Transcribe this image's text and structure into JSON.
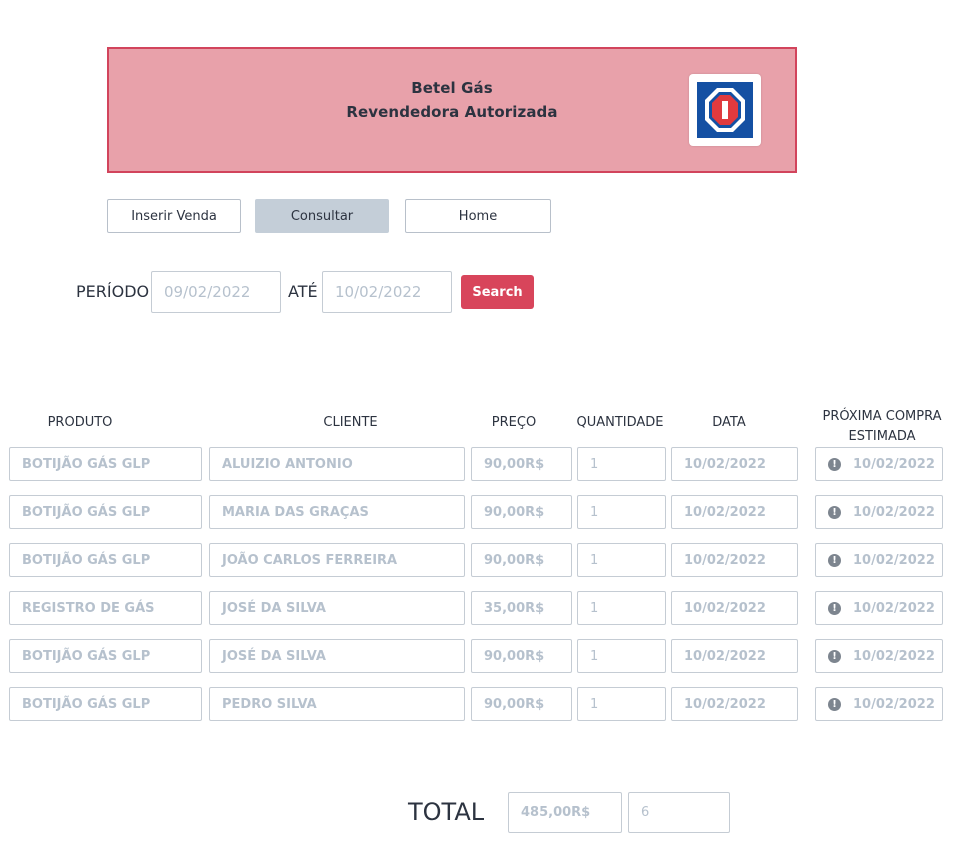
{
  "header": {
    "title_line1": "Betel Gás",
    "title_line2": "Revendedora Autorizada",
    "logo_icon": "gas-logo-icon",
    "banner_color": "#e8a1aa",
    "banner_border": "#d2445c"
  },
  "nav": {
    "insert_label": "Inserir Venda",
    "consult_label": "Consultar",
    "home_label": "Home"
  },
  "filter": {
    "period_label": "PERÍODO",
    "start_date": "09/02/2022",
    "until_label": "ATÉ",
    "end_date": "10/02/2022",
    "search_label": "Search",
    "search_color": "#d8455b"
  },
  "table": {
    "headers": {
      "produto": "PRODUTO",
      "cliente": "CLIENTE",
      "preco": "PREÇO",
      "quantidade": "QUANTIDADE",
      "data": "DATA",
      "proxima": "PRÓXIMA COMPRA ESTIMADA"
    },
    "rows": [
      {
        "produto": "BOTIJÃO GÁS GLP",
        "cliente": "ALUIZIO ANTONIO",
        "preco": "90,00R$",
        "quantidade": "1",
        "data": "10/02/2022",
        "proxima": "10/02/2022"
      },
      {
        "produto": "BOTIJÃO GÁS GLP",
        "cliente": "MARIA DAS GRAÇAS",
        "preco": "90,00R$",
        "quantidade": "1",
        "data": "10/02/2022",
        "proxima": "10/02/2022"
      },
      {
        "produto": "BOTIJÃO GÁS GLP",
        "cliente": "JOÃO CARLOS FERREIRA",
        "preco": "90,00R$",
        "quantidade": "1",
        "data": "10/02/2022",
        "proxima": "10/02/2022"
      },
      {
        "produto": "REGISTRO DE GÁS",
        "cliente": "JOSÉ DA SILVA",
        "preco": "35,00R$",
        "quantidade": "1",
        "data": "10/02/2022",
        "proxima": "10/02/2022"
      },
      {
        "produto": "BOTIJÃO GÁS GLP",
        "cliente": "JOSÉ DA SILVA",
        "preco": "90,00R$",
        "quantidade": "1",
        "data": "10/02/2022",
        "proxima": "10/02/2022"
      },
      {
        "produto": "BOTIJÃO GÁS GLP",
        "cliente": "PEDRO SILVA",
        "preco": "90,00R$",
        "quantidade": "1",
        "data": "10/02/2022",
        "proxima": "10/02/2022"
      }
    ],
    "alert_icon": "alert-icon"
  },
  "totals": {
    "label": "TOTAL",
    "amount": "485,00R$",
    "count": "6"
  }
}
